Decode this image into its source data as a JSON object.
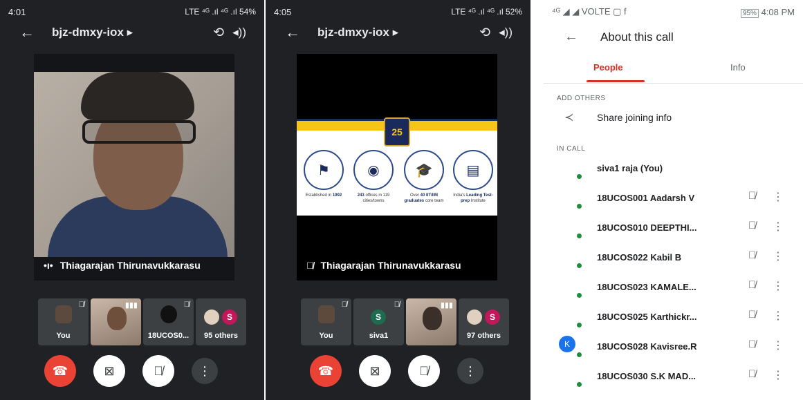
{
  "phone1": {
    "time": "4:01",
    "status_right": "LTE ⁴ᴳ .ıl ⁴ᴳ .ıl 54%",
    "meeting_title": "bjz-dmxy-iox ▸",
    "speaker_name": "Thiagarajan Thirunavukkarasu",
    "tiles": [
      {
        "label": "You"
      },
      {
        "label": ""
      },
      {
        "label": "18UCOS0..."
      },
      {
        "label": "95 others",
        "avatar": "S"
      }
    ]
  },
  "phone2": {
    "time": "4:05",
    "status_right": "LTE ⁴ᴳ .ıl ⁴ᴳ .ıl 52%",
    "meeting_title": "bjz-dmxy-iox ▸",
    "speaker_name": "Thiagarajan Thirunavukkarasu",
    "slide": {
      "crest": "25",
      "items": [
        {
          "icon": "flag-icon",
          "text_pre": "Established in",
          "text_bold": "1992",
          "text_post": ""
        },
        {
          "icon": "location-icon",
          "text_pre": "",
          "text_bold": "243",
          "text_post": "offices in 119 cities/towns"
        },
        {
          "icon": "graduation-cap-icon",
          "text_pre": "Over",
          "text_bold": "40 IIT/IIM graduates",
          "text_post": "core team"
        },
        {
          "icon": "document-icon",
          "text_pre": "India's",
          "text_bold": "Leading Test-prep",
          "text_post": "Institute"
        }
      ]
    },
    "tiles": [
      {
        "label": "You"
      },
      {
        "label": "siva1",
        "avatar": "S"
      },
      {
        "label": ""
      },
      {
        "label": "97 others",
        "avatar": "S"
      }
    ]
  },
  "about": {
    "time": "4:08 PM",
    "status_left": "⁴ᴳ ◢ ◢ VOLTE ▢ f",
    "battery": "95%",
    "title": "About this call",
    "tabs": [
      "People",
      "Info"
    ],
    "add_others_label": "ADD OTHERS",
    "share_label": "Share joining info",
    "in_call_label": "IN CALL",
    "participants": [
      {
        "name": "siva1 raja (You)",
        "muted": false
      },
      {
        "name": "18UCOS001 Aadarsh V",
        "muted": true
      },
      {
        "name": "18UCOS010 DEEPTHI...",
        "muted": true
      },
      {
        "name": "18UCOS022 Kabil B",
        "muted": true
      },
      {
        "name": "18UCOS023 KAMALE...",
        "muted": true
      },
      {
        "name": "18UCOS025 Karthickr...",
        "muted": true
      },
      {
        "name": "18UCOS028 Kavisree.R",
        "muted": true,
        "avatar": "K"
      },
      {
        "name": "18UCOS030 S.K MAD...",
        "muted": true
      }
    ]
  },
  "colors": {
    "end_call": "#ea4335",
    "tab_active": "#d93025",
    "online": "#1e8e3e",
    "avatar_s": "#c2185b"
  }
}
